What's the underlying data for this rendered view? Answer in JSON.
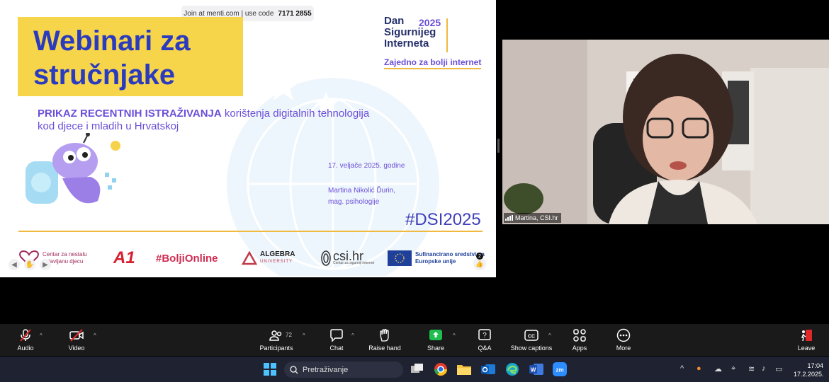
{
  "slide": {
    "menti_text": "Join at menti.com | use code",
    "menti_code": "7171 2855",
    "title_line1": "Webinari za",
    "title_line2": "stručnjake",
    "logo_name_line1": "Dan",
    "logo_name_line2": "Sigurnijeg",
    "logo_name_line3": "Interneta",
    "logo_year": "2025",
    "logo_tagline": "Zajedno za bolji internet",
    "subtitle_bold": "PRIKAZ RECENTNIH ISTRAŽIVANJA",
    "subtitle_rest": " korištenja digitalnih tehnologija",
    "subtitle_line2": "kod djece i mladih u Hrvatskoj",
    "date": "17. veljače 2025. godine",
    "author_name": "Martina Nikolić Ďurin,",
    "author_title": "mag. psihologije",
    "hashtag": "#DSI2025",
    "sponsors": {
      "centar_line1": "Centar za nestalu",
      "centar_line2": "ostavljanu djecu",
      "a1": "A1",
      "bolji": "#BoljiOnline",
      "algebra": "ALGEBRA",
      "algebra_sub": "UNIVERSITY",
      "csi": "csi.hr",
      "csi_sub": "Centar za sigurniji internet",
      "eu_line1": "Sufinancirano sredstvima",
      "eu_line2": "Europske unije"
    },
    "like_count": "2"
  },
  "video": {
    "participant_name": "Martina, CSI.hr"
  },
  "toolbar": {
    "audio": "Audio",
    "video": "Video",
    "participants": "Participants",
    "participants_count": "72",
    "chat": "Chat",
    "raise_hand": "Raise hand",
    "share": "Share",
    "qa": "Q&A",
    "captions": "Show captions",
    "apps": "Apps",
    "more": "More",
    "leave": "Leave"
  },
  "taskbar": {
    "search_placeholder": "Pretraživanje",
    "time": "17:04",
    "date": "17.2.2025."
  },
  "colors": {
    "title_yellow": "#f7d54a",
    "title_blue": "#2b3bbf",
    "accent_purple": "#6b4fd8",
    "share_green": "#1fbf4f",
    "toolbar_bg": "#1a1a1a",
    "taskbar_bg": "#1f2230"
  }
}
